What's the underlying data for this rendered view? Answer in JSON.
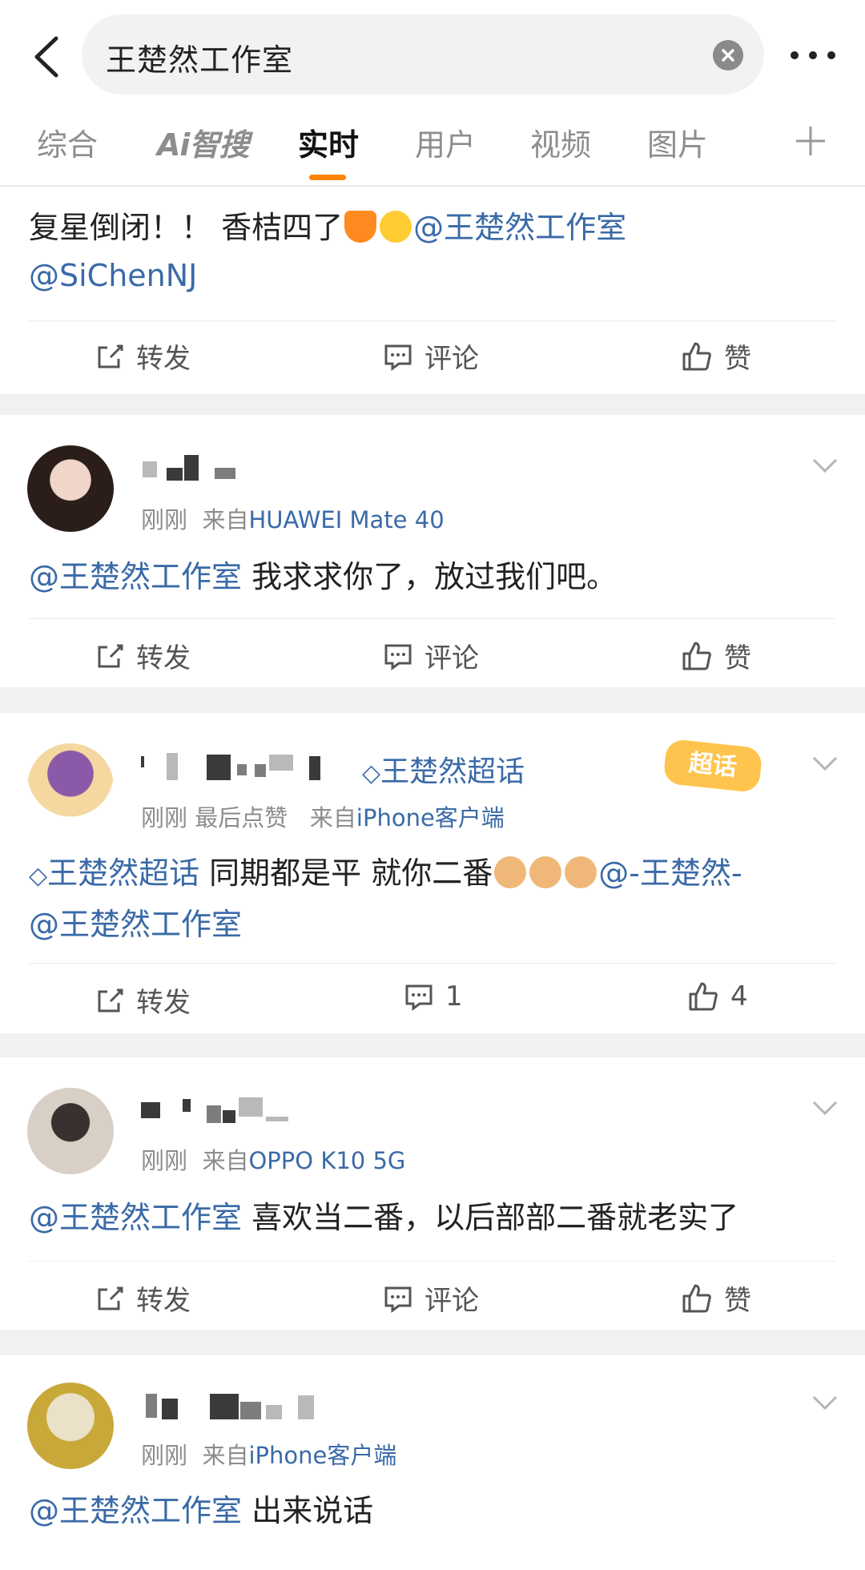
{
  "search": {
    "query": "王楚然工作室"
  },
  "tabs": [
    {
      "label": "综合"
    },
    {
      "label": "Ai智搜"
    },
    {
      "label": "实时"
    },
    {
      "label": "用户"
    },
    {
      "label": "视频"
    },
    {
      "label": "图片"
    }
  ],
  "actions": {
    "repost": "转发",
    "comment": "评论",
    "like": "赞"
  },
  "post0": {
    "text": "复星倒闭！！ 香桔四了",
    "mention1": "@王楚然工作室",
    "mention2": "@SiChenNJ"
  },
  "post1": {
    "time": "刚刚",
    "source_prefix": "来自",
    "source": "HUAWEI Mate 40",
    "mention": "@王楚然工作室",
    "text": " 我求求你了，放过我们吧。"
  },
  "post2": {
    "topic_tag": "王楚然超话",
    "badge": "超话",
    "time": "刚刚",
    "liked_label": "最后点赞",
    "source_prefix": "来自",
    "source": "iPhone客户端",
    "topic": "王楚然超话",
    "text": " 同期都是平 就你二番",
    "mention1": "@-王楚然-",
    "mention2": "@王楚然工作室",
    "comment_count": "1",
    "like_count": "4"
  },
  "post3": {
    "time": "刚刚",
    "source_prefix": "来自",
    "source": "OPPO K10 5G",
    "mention": "@王楚然工作室",
    "text": " 喜欢当二番，以后部部二番就老实了"
  },
  "post4": {
    "time": "刚刚",
    "source_prefix": "来自",
    "source": "iPhone客户端",
    "mention": "@王楚然工作室",
    "text": " 出来说话"
  },
  "colors": {
    "accent": "#ff8200",
    "link": "#3a6aa7"
  }
}
